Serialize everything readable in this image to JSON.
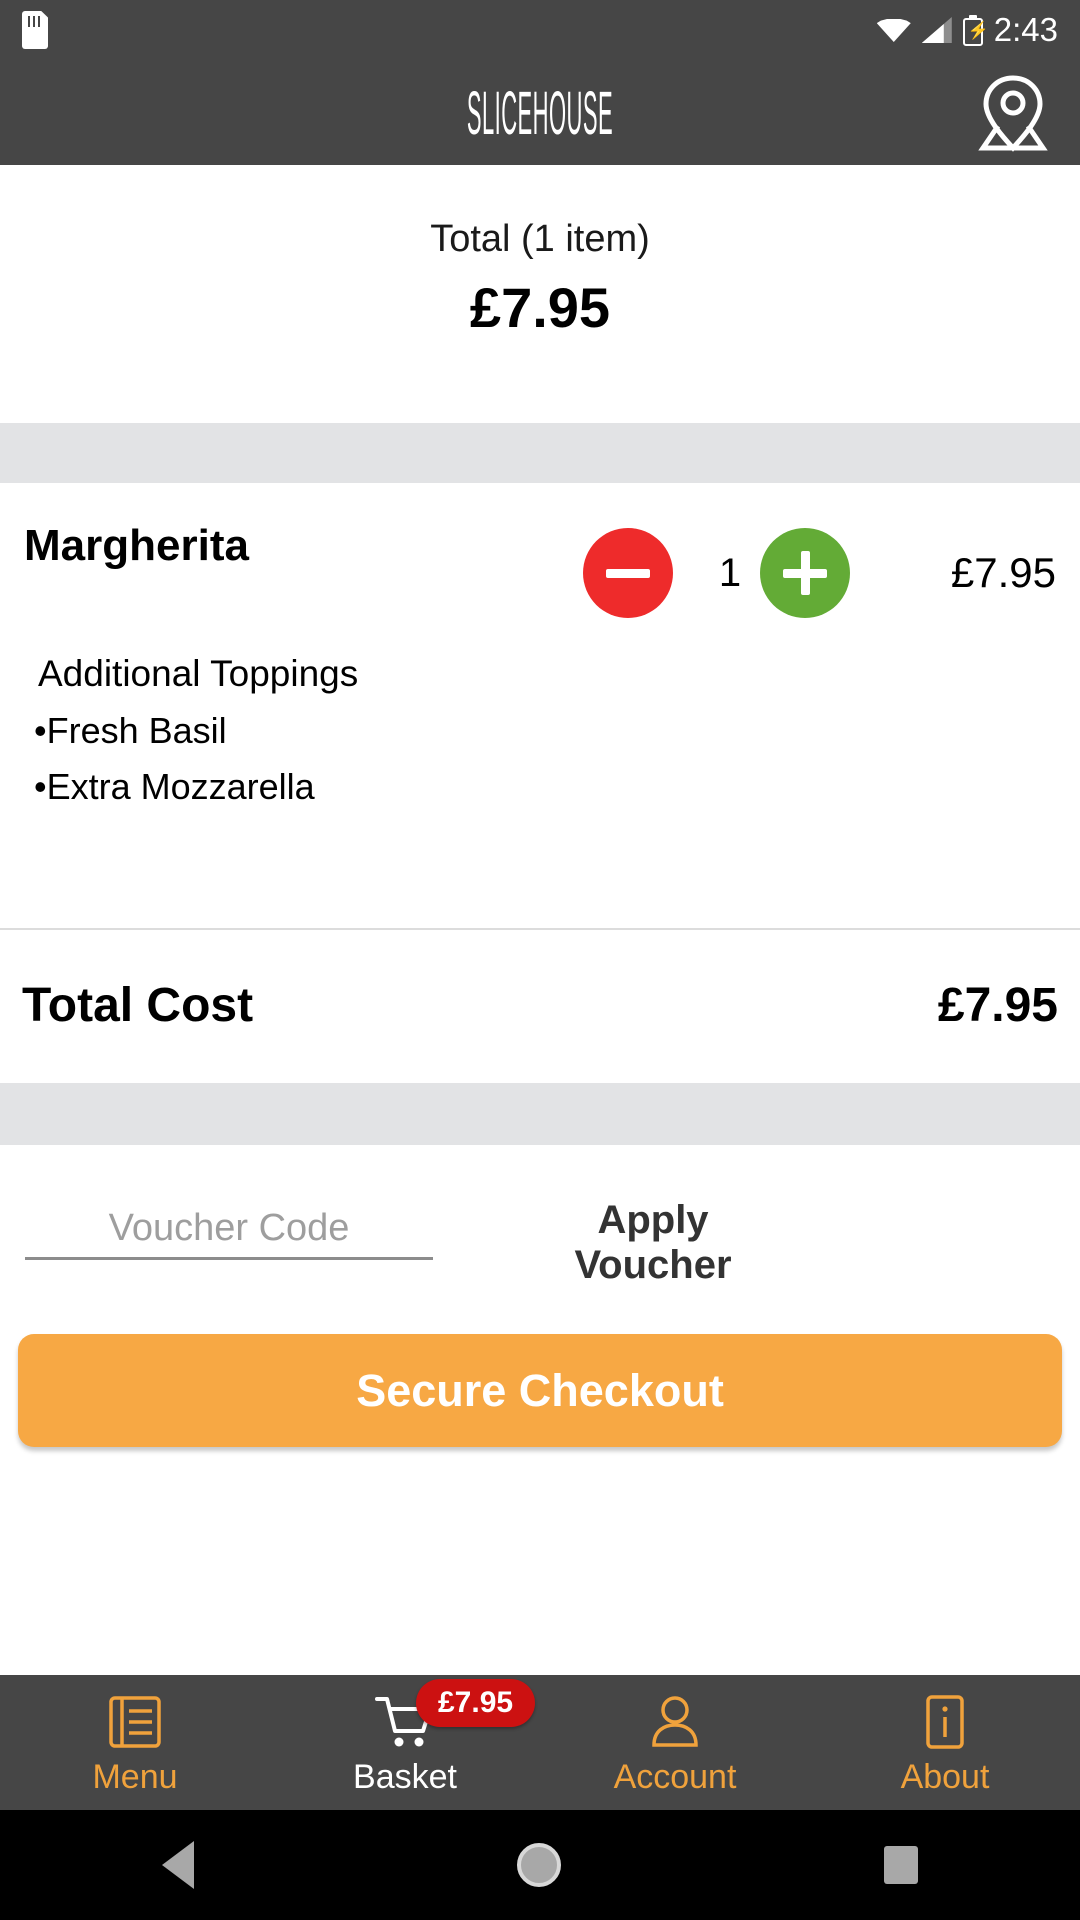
{
  "statusbar": {
    "clock": "2:43",
    "sd_card_icon": "sd-card-icon",
    "wifi_icon": "wifi-icon",
    "signal_icon": "signal-icon",
    "battery_icon": "battery-charging-icon"
  },
  "header": {
    "brand": "SLICEHOUSE",
    "location_icon": "location-pin-icon"
  },
  "summary": {
    "label": "Total (1 item)",
    "amount": "£7.95"
  },
  "item": {
    "name": "Margherita",
    "quantity": "1",
    "price": "£7.95",
    "decrease_icon": "minus-circle-icon",
    "increase_icon": "plus-circle-icon",
    "toppings_title": "Additional Toppings",
    "toppings": [
      "•Fresh Basil",
      "•Extra Mozzarella"
    ]
  },
  "total_cost": {
    "label": "Total Cost",
    "value": "£7.95"
  },
  "voucher": {
    "placeholder": "Voucher Code",
    "value": "",
    "apply_label": "Apply Voucher"
  },
  "checkout": {
    "label": "Secure Checkout"
  },
  "bottomnav": {
    "basket_badge": "£7.95",
    "items": [
      {
        "label": "Menu",
        "icon": "menu-book-icon"
      },
      {
        "label": "Basket",
        "icon": "shopping-cart-icon"
      },
      {
        "label": "Account",
        "icon": "person-icon"
      },
      {
        "label": "About",
        "icon": "info-icon"
      }
    ]
  },
  "androidnav": {
    "back_icon": "back-triangle-icon",
    "home_icon": "home-circle-icon",
    "recents_icon": "recents-square-icon"
  },
  "colors": {
    "header_bg": "#464646",
    "accent_orange": "#f0a23c",
    "checkout_orange": "#f7a844",
    "minus_red": "#ee2b2b",
    "plus_green": "#63ab36",
    "badge_red": "#cc1111",
    "band_gray": "#e2e3e5"
  }
}
